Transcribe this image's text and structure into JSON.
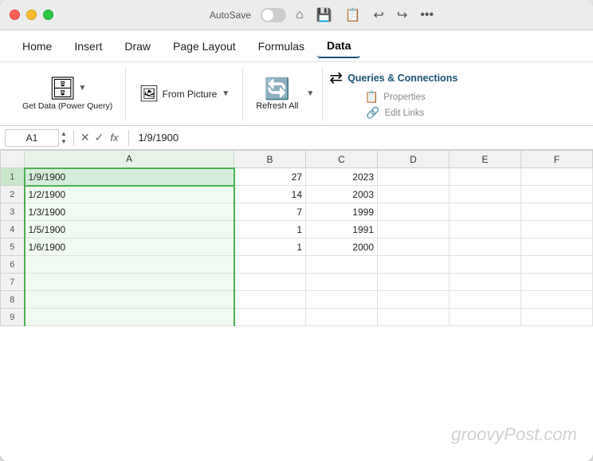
{
  "titlebar": {
    "autosave_label": "AutoSave",
    "icons": [
      "home",
      "save",
      "save-as",
      "undo",
      "redo",
      "more"
    ]
  },
  "menubar": {
    "items": [
      "Home",
      "Insert",
      "Draw",
      "Page Layout",
      "Formulas",
      "Data"
    ],
    "active": "Data"
  },
  "ribbon": {
    "get_data_label": "Get Data (Power Query)",
    "from_picture_label": "From Picture",
    "refresh_all_label": "Refresh All",
    "queries_connections_label": "Queries & Connections",
    "properties_label": "Properties",
    "edit_links_label": "Edit Links"
  },
  "formulabar": {
    "cell_ref": "A1",
    "formula_value": "1/9/1900"
  },
  "columns": {
    "row_header": "",
    "cols": [
      "A",
      "B",
      "C",
      "D",
      "E",
      "F"
    ]
  },
  "rows": [
    {
      "num": "1",
      "a": "1/9/1900",
      "b": "27",
      "c": "2023",
      "d": "",
      "e": "",
      "f": ""
    },
    {
      "num": "2",
      "a": "1/2/1900",
      "b": "14",
      "c": "2003",
      "d": "",
      "e": "",
      "f": ""
    },
    {
      "num": "3",
      "a": "1/3/1900",
      "b": "7",
      "c": "1999",
      "d": "",
      "e": "",
      "f": ""
    },
    {
      "num": "4",
      "a": "1/5/1900",
      "b": "1",
      "c": "1991",
      "d": "",
      "e": "",
      "f": ""
    },
    {
      "num": "5",
      "a": "1/6/1900",
      "b": "1",
      "c": "2000",
      "d": "",
      "e": "",
      "f": ""
    },
    {
      "num": "6",
      "a": "",
      "b": "",
      "c": "",
      "d": "",
      "e": "",
      "f": ""
    },
    {
      "num": "7",
      "a": "",
      "b": "",
      "c": "",
      "d": "",
      "e": "",
      "f": ""
    },
    {
      "num": "8",
      "a": "",
      "b": "",
      "c": "",
      "d": "",
      "e": "",
      "f": ""
    },
    {
      "num": "9",
      "a": "",
      "b": "",
      "c": "",
      "d": "",
      "e": "",
      "f": ""
    }
  ],
  "watermark": "groovyPost.com"
}
